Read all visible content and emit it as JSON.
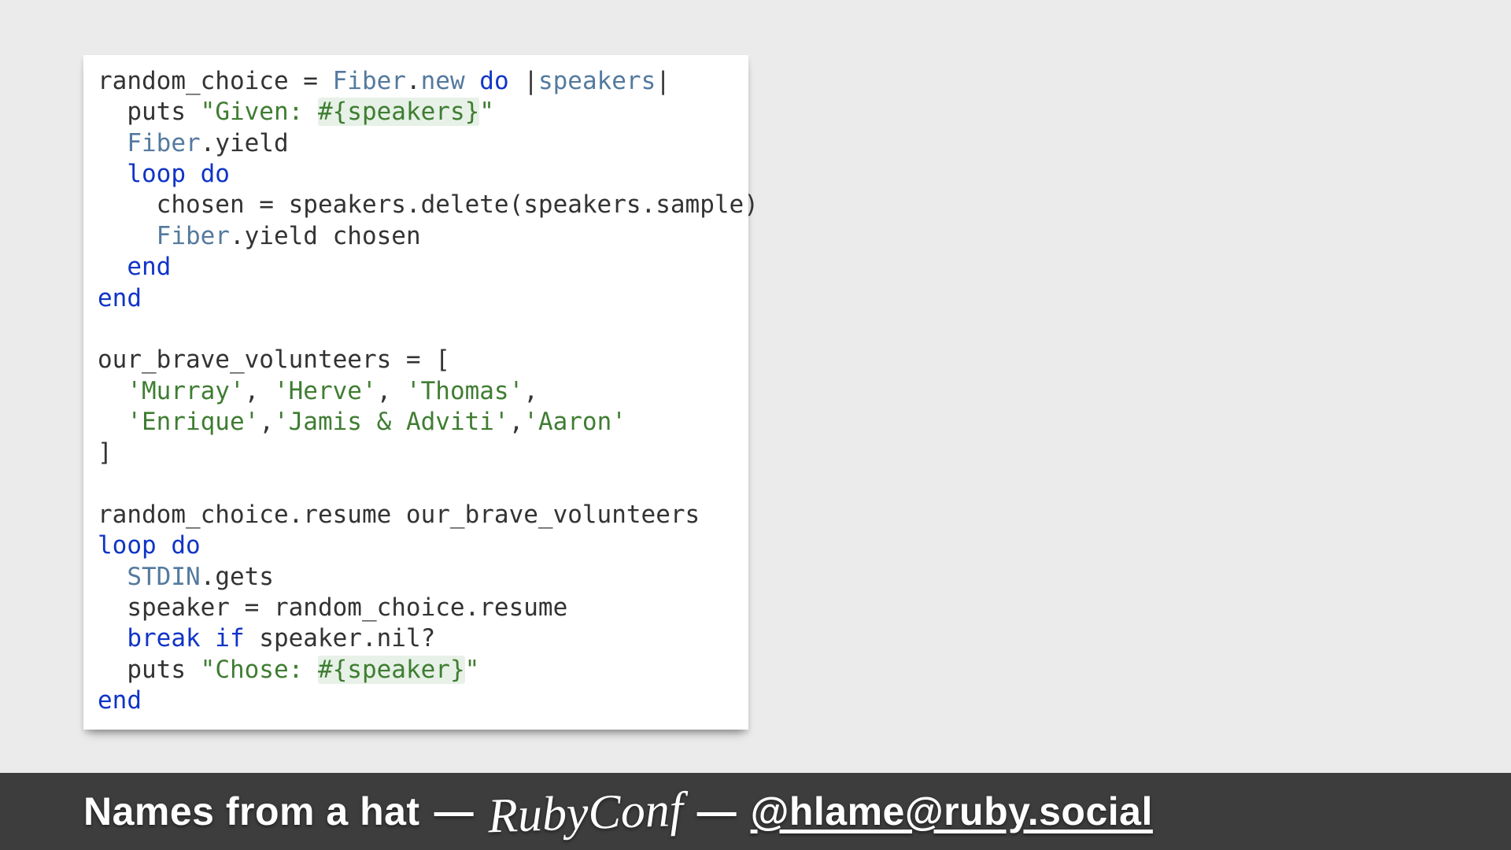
{
  "code": {
    "tokens": [
      [
        [
          "id",
          "random_choice = "
        ],
        [
          "const",
          "Fiber"
        ],
        [
          "id",
          "."
        ],
        [
          "call",
          "new"
        ],
        [
          "id",
          " "
        ],
        [
          "kw",
          "do"
        ],
        [
          "id",
          " |"
        ],
        [
          "pipevar",
          "speakers"
        ],
        [
          "id",
          "|"
        ]
      ],
      [
        [
          "id",
          "  puts "
        ],
        [
          "str",
          "\"Given: "
        ],
        [
          "interp",
          "#{speakers}"
        ],
        [
          "str",
          "\""
        ]
      ],
      [
        [
          "id",
          "  "
        ],
        [
          "const",
          "Fiber"
        ],
        [
          "id",
          ".yield"
        ]
      ],
      [
        [
          "id",
          "  "
        ],
        [
          "kw",
          "loop do"
        ]
      ],
      [
        [
          "id",
          "    chosen = speakers.delete(speakers.sample)"
        ]
      ],
      [
        [
          "id",
          "    "
        ],
        [
          "const",
          "Fiber"
        ],
        [
          "id",
          ".yield chosen"
        ]
      ],
      [
        [
          "id",
          "  "
        ],
        [
          "kw",
          "end"
        ]
      ],
      [
        [
          "kw",
          "end"
        ]
      ],
      [
        [
          "id",
          ""
        ]
      ],
      [
        [
          "id",
          "our_brave_volunteers = ["
        ]
      ],
      [
        [
          "id",
          "  "
        ],
        [
          "str",
          "'Murray'"
        ],
        [
          "id",
          ", "
        ],
        [
          "str",
          "'Herve'"
        ],
        [
          "id",
          ", "
        ],
        [
          "str",
          "'Thomas'"
        ],
        [
          "id",
          ","
        ]
      ],
      [
        [
          "id",
          "  "
        ],
        [
          "str",
          "'Enrique'"
        ],
        [
          "id",
          ","
        ],
        [
          "str",
          "'Jamis & Adviti'"
        ],
        [
          "id",
          ","
        ],
        [
          "str",
          "'Aaron'"
        ]
      ],
      [
        [
          "id",
          "]"
        ]
      ],
      [
        [
          "id",
          ""
        ]
      ],
      [
        [
          "id",
          "random_choice.resume our_brave_volunteers"
        ]
      ],
      [
        [
          "kw",
          "loop do"
        ]
      ],
      [
        [
          "id",
          "  "
        ],
        [
          "const",
          "STDIN"
        ],
        [
          "id",
          ".gets"
        ]
      ],
      [
        [
          "id",
          "  speaker = random_choice.resume"
        ]
      ],
      [
        [
          "id",
          "  "
        ],
        [
          "kw",
          "break if"
        ],
        [
          "id",
          " speaker.nil?"
        ]
      ],
      [
        [
          "id",
          "  puts "
        ],
        [
          "str",
          "\"Chose: "
        ],
        [
          "interp",
          "#{speaker}"
        ],
        [
          "str",
          "\""
        ]
      ],
      [
        [
          "kw",
          "end"
        ]
      ]
    ]
  },
  "footer": {
    "title": "Names from a hat",
    "dash": "—",
    "conf": "RubyConf",
    "handle": "@hlame@ruby.social"
  }
}
